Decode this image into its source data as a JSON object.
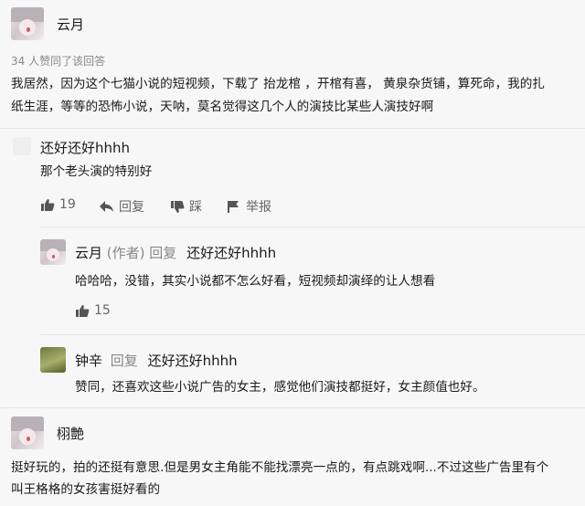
{
  "answer": {
    "author": "云月",
    "upvote_text": "34 人赞同了该回答",
    "content_line1": "我居然，因为这个七猫小说的短视频，下载了 抬龙棺 ，开棺有喜， 黄泉杂货铺，算死命，我的扎",
    "content_line2": "纸生涯，等等的恐怖小说，天呐，莫名觉得这几个人的演技比某些人演技好啊"
  },
  "comment1": {
    "author": "还好还好hhhh",
    "text": "那个老头演的特别好",
    "likes": "19",
    "reply_label": "回复",
    "dislike_label": "踩",
    "report_label": "举报"
  },
  "reply1": {
    "author": "云月",
    "author_tag": "(作者)",
    "reply_word": "回复",
    "target": "还好还好hhhh",
    "text": "哈哈哈，没错，其实小说都不怎么好看，短视频却演绎的让人想看",
    "likes": "15"
  },
  "reply2": {
    "author": "钟辛",
    "reply_word": "回复",
    "target": "还好还好hhhh",
    "text": "赞同，还喜欢这些小说广告的女主，感觉他们演技都挺好，女主颜值也好。"
  },
  "comment2": {
    "author": "栩艶",
    "text_line1": "挺好玩的，拍的还挺有意思.但是男女主角能不能找漂亮一点的，有点跳戏啊...不过这些广告里有个",
    "text_line2": "叫王格格的女孩害挺好看的"
  }
}
